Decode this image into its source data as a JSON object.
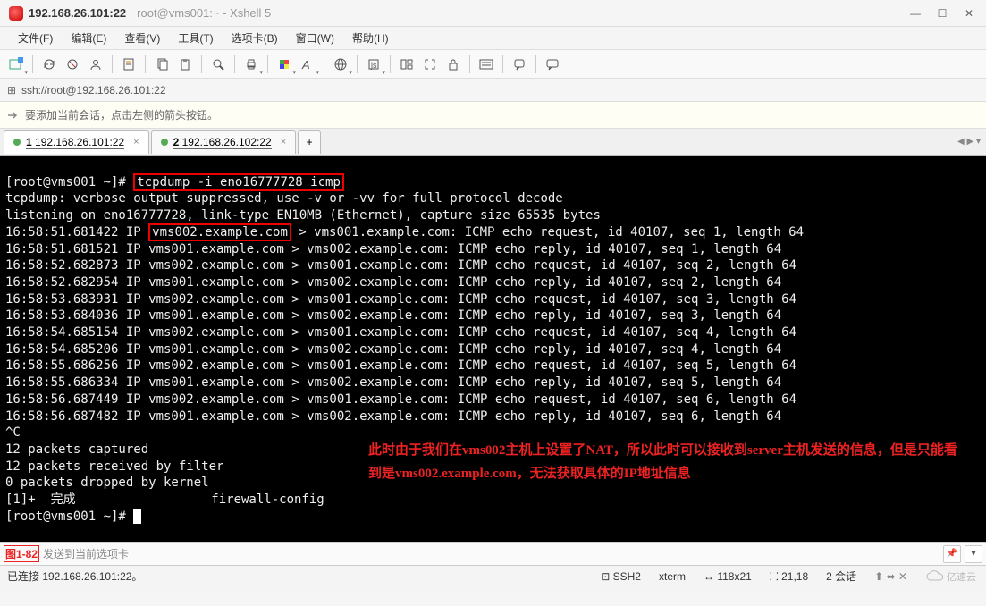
{
  "title": {
    "ip": "192.168.26.101:22",
    "session": "root@vms001:~ - Xshell 5"
  },
  "window_controls": {
    "min": "—",
    "max": "☐",
    "close": "✕"
  },
  "menu": [
    "文件(F)",
    "编辑(E)",
    "查看(V)",
    "工具(T)",
    "选项卡(B)",
    "窗口(W)",
    "帮助(H)"
  ],
  "address": {
    "url": "ssh://root@192.168.26.101:22",
    "lock": "⊡"
  },
  "msgbar": "要添加当前会话，点击左侧的箭头按钮。",
  "tabs": {
    "items": [
      {
        "num": "1",
        "label": "192.168.26.101:22"
      },
      {
        "num": "2",
        "label": "192.168.26.102:22"
      }
    ],
    "add": "+"
  },
  "term": {
    "prompt1": "[root@vms001 ~]# ",
    "cmd": "tcpdump -i eno16777728 icmp",
    "l2": "tcpdump: verbose output suppressed, use -v or -vv for full protocol decode",
    "l3": "listening on eno16777728, link-type EN10MB (Ethernet), capture size 65535 bytes",
    "l4a": "16:58:51.681422 IP ",
    "l4host": "vms002.example.com",
    "l4b": " > vms001.example.com: ICMP echo request, id 40107, seq 1, length 64",
    "lines": [
      "16:58:51.681521 IP vms001.example.com > vms002.example.com: ICMP echo reply, id 40107, seq 1, length 64",
      "16:58:52.682873 IP vms002.example.com > vms001.example.com: ICMP echo request, id 40107, seq 2, length 64",
      "16:58:52.682954 IP vms001.example.com > vms002.example.com: ICMP echo reply, id 40107, seq 2, length 64",
      "16:58:53.683931 IP vms002.example.com > vms001.example.com: ICMP echo request, id 40107, seq 3, length 64",
      "16:58:53.684036 IP vms001.example.com > vms002.example.com: ICMP echo reply, id 40107, seq 3, length 64",
      "16:58:54.685154 IP vms002.example.com > vms001.example.com: ICMP echo request, id 40107, seq 4, length 64",
      "16:58:54.685206 IP vms001.example.com > vms002.example.com: ICMP echo reply, id 40107, seq 4, length 64",
      "16:58:55.686256 IP vms002.example.com > vms001.example.com: ICMP echo request, id 40107, seq 5, length 64",
      "16:58:55.686334 IP vms001.example.com > vms002.example.com: ICMP echo reply, id 40107, seq 5, length 64",
      "16:58:56.687449 IP vms002.example.com > vms001.example.com: ICMP echo request, id 40107, seq 6, length 64",
      "16:58:56.687482 IP vms001.example.com > vms002.example.com: ICMP echo reply, id 40107, seq 6, length 64"
    ],
    "ctrlc": "^C",
    "s1": "12 packets captured",
    "s2": "12 packets received by filter",
    "s3": "0 packets dropped by kernel",
    "job": "[1]+  完成                  firewall-config",
    "prompt2": "[root@vms001 ~]# ",
    "annot": "此时由于我们在vms002主机上设置了NAT，所以此时可以接收到server主机发送的信息，但是只能看到是vms002.example.com，无法获取具体的IP地址信息"
  },
  "inputbar": {
    "fig": "图1-82",
    "hint": "发送到当前选项卡"
  },
  "status": {
    "conn": "已连接 192.168.26.101:22。",
    "ssh": "SSH2",
    "term": "xterm",
    "size": "118x21",
    "pos": "21,18",
    "sess": "2 会话",
    "brand": "亿速云"
  }
}
